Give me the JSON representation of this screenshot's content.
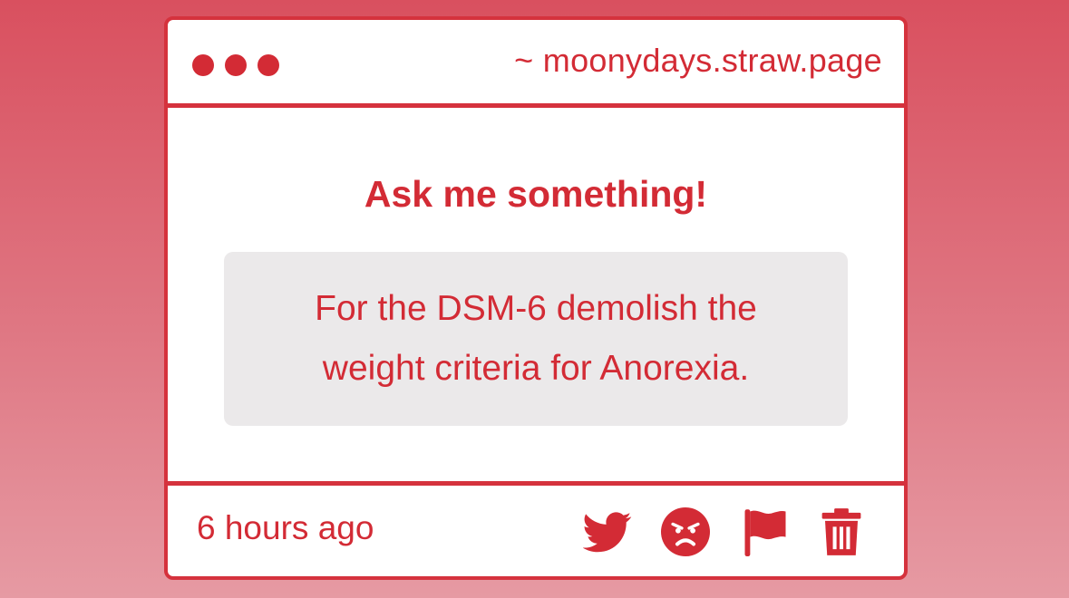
{
  "window": {
    "url": "~ moonydays.straw.page"
  },
  "main": {
    "heading": "Ask me something!",
    "question": "For the DSM-6 demolish the weight criteria for Anorexia."
  },
  "footer": {
    "timestamp": "6 hours ago",
    "actions": [
      {
        "icon": "twitter-icon"
      },
      {
        "icon": "angry-face-icon"
      },
      {
        "icon": "flag-icon"
      },
      {
        "icon": "trash-icon"
      }
    ]
  },
  "colors": {
    "accent": "#d32b35",
    "question_bg": "#ebe9ea",
    "background_top": "#d9505f",
    "background_bottom": "#e69aa3"
  }
}
